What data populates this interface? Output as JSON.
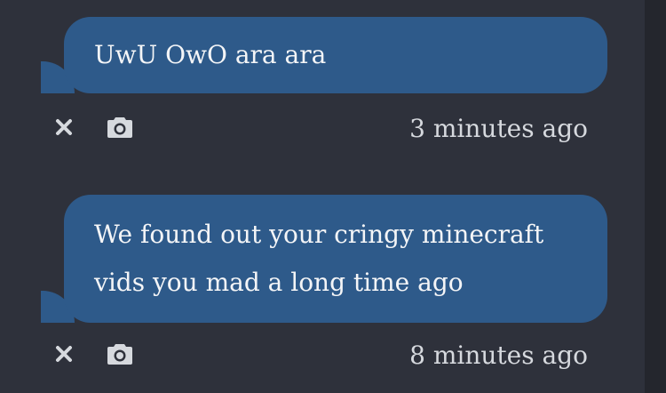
{
  "theme": {
    "background": "#24262d",
    "panel": "#2e313b",
    "bubble": "#2e5a8a",
    "bubble_text": "#f4f5f7",
    "meta_text": "#d6d9de"
  },
  "messages": [
    {
      "text": "UwU OwO ara ara",
      "timestamp": "3 minutes ago",
      "actions": {
        "delete_icon": "close-icon",
        "screenshot_icon": "camera-icon"
      }
    },
    {
      "text": "We found out your cringy minecraft vids you mad a long time ago",
      "timestamp": "8 minutes ago",
      "actions": {
        "delete_icon": "close-icon",
        "screenshot_icon": "camera-icon"
      }
    }
  ]
}
